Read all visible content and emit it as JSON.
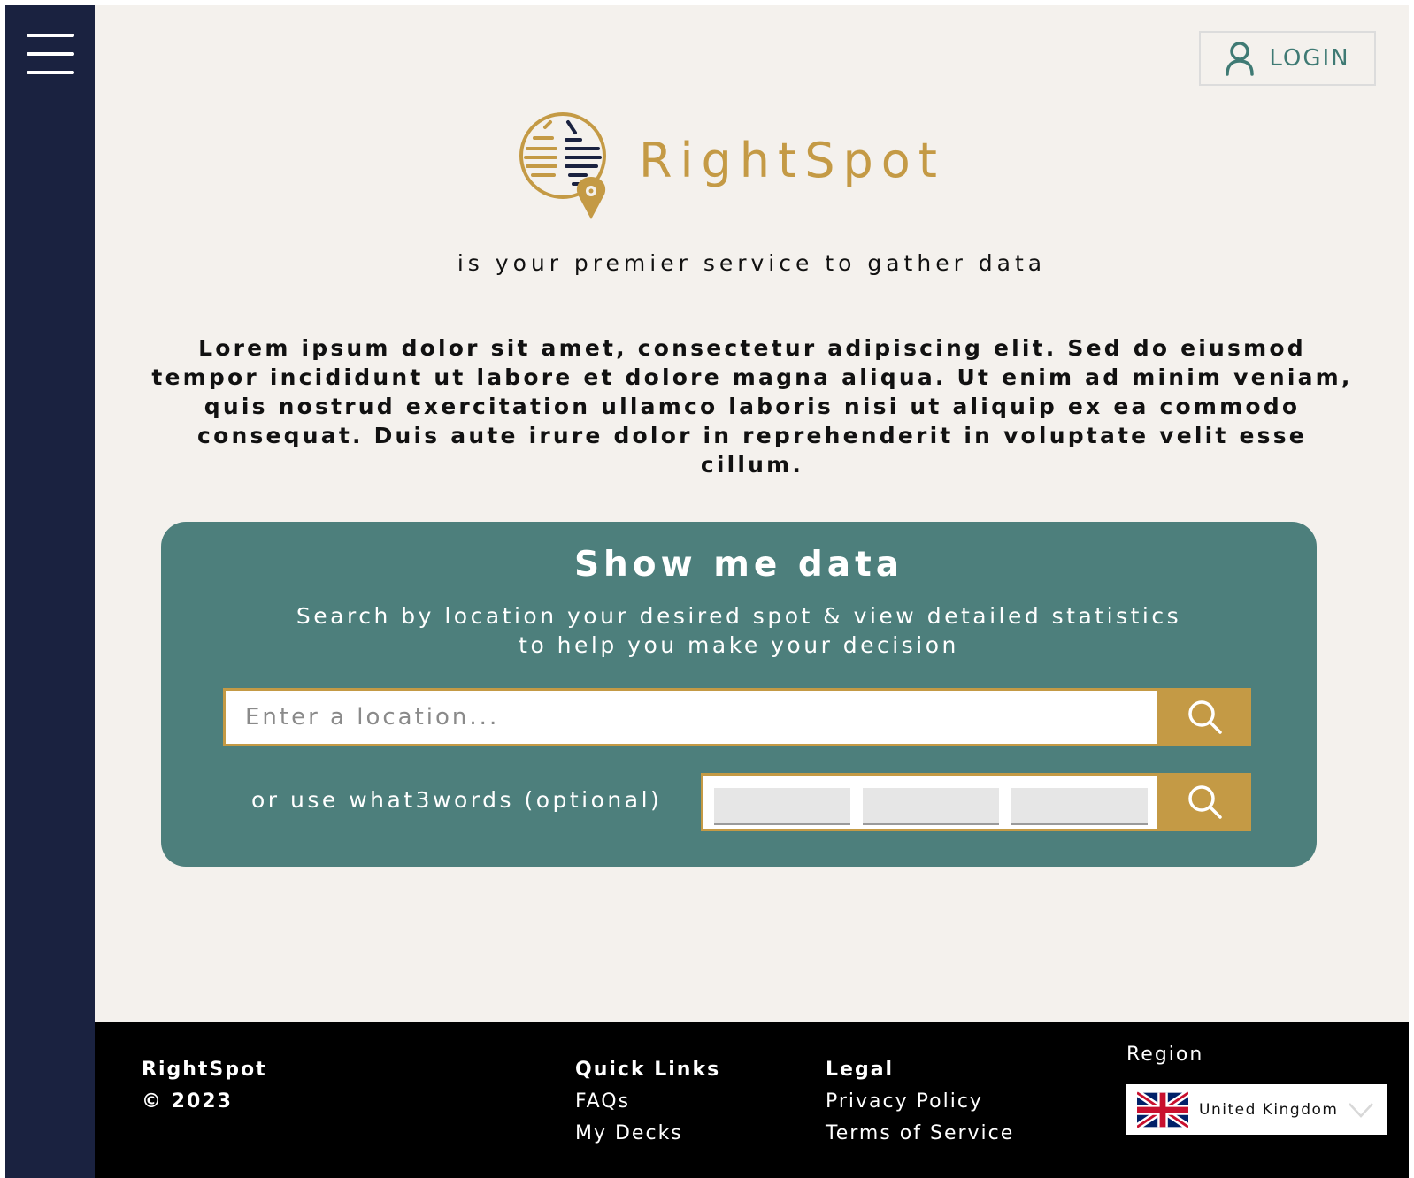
{
  "brand": {
    "name": "RightSpot",
    "tagline": "is your premier service to gather data",
    "accent_color": "#c49a45",
    "teal_color": "#4d7f7c",
    "navy_color": "#1a2240"
  },
  "header": {
    "login_label": "LOGIN",
    "login_icon": "user-icon",
    "menu_icon": "hamburger-menu-icon"
  },
  "intro": {
    "text": "Lorem ipsum dolor sit amet, consectetur adipiscing elit. Sed do eiusmod tempor incididunt ut labore et dolore magna aliqua. Ut enim ad minim veniam, quis nostrud exercitation ullamco laboris nisi ut aliquip ex ea commodo consequat. Duis aute irure dolor in reprehenderit in voluptate velit esse cillum."
  },
  "search": {
    "title": "Show me data",
    "subtitle_line1": "Search by location your desired spot & view detailed statistics",
    "subtitle_line2": "to help you make your decision",
    "location_placeholder": "Enter a location...",
    "location_value": "",
    "w3w_label": "or use what3words (optional)",
    "w3w_values": [
      "",
      "",
      ""
    ],
    "search_icon": "search-icon"
  },
  "footer": {
    "brand": "RightSpot",
    "copyright": "© 2023",
    "quick_links": {
      "heading": "Quick Links",
      "items": [
        "FAQs",
        "My Decks"
      ]
    },
    "legal": {
      "heading": "Legal",
      "items": [
        "Privacy Policy",
        "Terms of Service"
      ]
    },
    "region": {
      "label": "Region",
      "selected": "United Kingdom",
      "flag_icon": "uk-flag-icon"
    }
  }
}
